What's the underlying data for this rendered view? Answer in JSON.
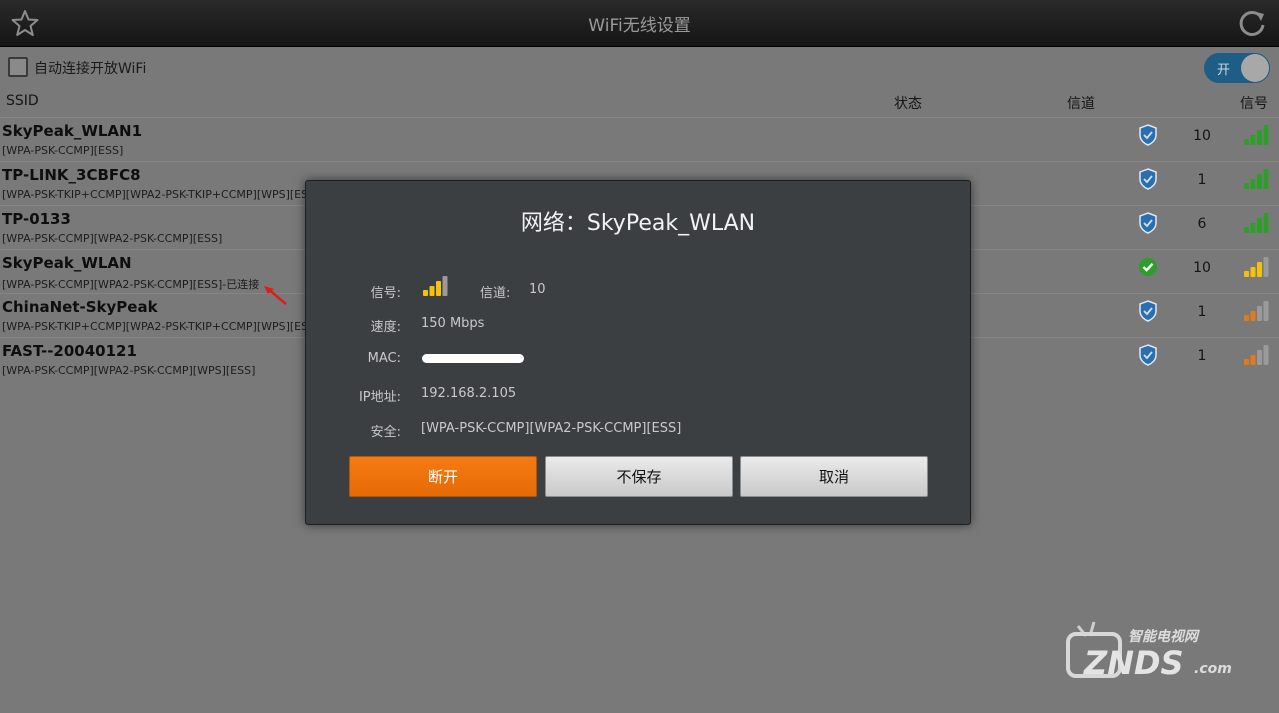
{
  "titlebar": {
    "title": "WiFi无线设置"
  },
  "auto_connect": {
    "label": "自动连接开放WiFi",
    "checked": false
  },
  "toggle": {
    "label": "开",
    "state": "on"
  },
  "columns": {
    "ssid": "SSID",
    "status": "状态",
    "channel": "信道",
    "signal": "信号"
  },
  "networks": [
    {
      "ssid": "SkyPeak_WLAN1",
      "security": "[WPA-PSK-CCMP][ESS]",
      "channel": "10",
      "signal_level": 4,
      "signal_color": "green",
      "icon": "shield-icon"
    },
    {
      "ssid": "TP-LINK_3CBFC8",
      "security": "[WPA-PSK-TKIP+CCMP][WPA2-PSK-TKIP+CCMP][WPS][ESS]",
      "channel": "1",
      "signal_level": 4,
      "signal_color": "green",
      "icon": "shield-icon"
    },
    {
      "ssid": "TP-0133",
      "security": "[WPA-PSK-CCMP][WPA2-PSK-CCMP][ESS]",
      "channel": "6",
      "signal_level": 4,
      "signal_color": "green",
      "icon": "shield-icon"
    },
    {
      "ssid": "SkyPeak_WLAN",
      "security": "[WPA-PSK-CCMP][WPA2-PSK-CCMP][ESS]-已连接",
      "channel": "10",
      "signal_level": 3,
      "signal_color": "yellow",
      "icon": "check-icon"
    },
    {
      "ssid": "ChinaNet-SkyPeak",
      "security": "[WPA-PSK-TKIP+CCMP][WPA2-PSK-TKIP+CCMP][WPS][ESS]",
      "channel": "1",
      "signal_level": 2,
      "signal_color": "orange",
      "icon": "shield-icon"
    },
    {
      "ssid": "FAST--20040121",
      "security": "[WPA-PSK-CCMP][WPA2-PSK-CCMP][WPS][ESS]",
      "channel": "1",
      "signal_level": 2,
      "signal_color": "orange",
      "icon": "shield-icon"
    }
  ],
  "dialog": {
    "title": "网络：SkyPeak_WLAN",
    "signal_label": "信号:",
    "signal_level": 3,
    "channel_label": "信道:",
    "channel_value": "10",
    "speed_label": "速度:",
    "speed_value": "150 Mbps",
    "mac_label": "MAC:",
    "ip_label": "IP地址:",
    "ip_value": "192.168.2.105",
    "security_label": "安全:",
    "security_value": "[WPA-PSK-CCMP][WPA2-PSK-CCMP][ESS]",
    "buttons": {
      "disconnect": "断开",
      "forget": "不保存",
      "cancel": "取消"
    }
  },
  "watermark": {
    "cn": "智能电视网",
    "brand": "ZNDS",
    "suffix": ".com"
  },
  "colors": {
    "accent_orange": "#f07410",
    "toggle_blue": "#1d5d86",
    "signal_green": "#2e9e2a",
    "signal_yellow": "#f4c20d",
    "signal_orange": "#e07b18",
    "shield_blue": "#2a6fb0",
    "check_green": "#2e9e2a"
  }
}
